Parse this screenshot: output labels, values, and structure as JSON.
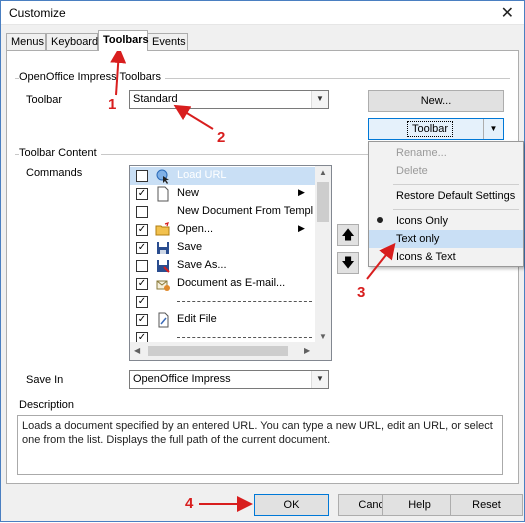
{
  "window": {
    "title": "Customize",
    "close_glyph": "✕"
  },
  "tabs": [
    {
      "label": "Menus",
      "active": false
    },
    {
      "label": "Keyboard",
      "active": false
    },
    {
      "label": "Toolbars",
      "active": true
    },
    {
      "label": "Events",
      "active": false
    }
  ],
  "toolbars_group": {
    "label": "OpenOffice Impress Toolbars",
    "toolbar_label": "Toolbar",
    "toolbar_value": "Standard",
    "new_button": "New...",
    "toolbar_button": "Toolbar"
  },
  "content_group": {
    "label": "Toolbar Content",
    "commands_label": "Commands",
    "items": [
      {
        "label": "Load URL",
        "checked": false,
        "icon": "globe-cursor-icon",
        "submenu": false,
        "selected": true
      },
      {
        "label": "New",
        "checked": true,
        "icon": "new-doc-icon",
        "submenu": true,
        "selected": false
      },
      {
        "label": "New Document From Templ",
        "checked": false,
        "icon": "template-icon",
        "submenu": false,
        "selected": false
      },
      {
        "label": "Open...",
        "checked": true,
        "icon": "open-folder-icon",
        "submenu": true,
        "selected": false
      },
      {
        "label": "Save",
        "checked": true,
        "icon": "floppy-icon",
        "submenu": false,
        "selected": false
      },
      {
        "label": "Save As...",
        "checked": false,
        "icon": "floppy-as-icon",
        "submenu": false,
        "selected": false
      },
      {
        "label": "Document as E-mail...",
        "checked": true,
        "icon": "email-icon",
        "submenu": false,
        "selected": false
      },
      {
        "label": "",
        "checked": true,
        "separator": true
      },
      {
        "label": "Edit File",
        "checked": true,
        "icon": "edit-file-icon",
        "submenu": false,
        "selected": false
      },
      {
        "label": "",
        "checked": true,
        "separator": true
      }
    ],
    "move_up_glyph": "🡅",
    "move_down_glyph": "🡇",
    "save_in_label": "Save In",
    "save_in_value": "OpenOffice Impress"
  },
  "toolbar_menu": {
    "items": [
      {
        "label": "Rename...",
        "disabled": true
      },
      {
        "label": "Delete",
        "disabled": true
      },
      {
        "label": "Restore Default Settings",
        "disabled": false
      },
      {
        "label": "Icons Only",
        "disabled": false,
        "bullet": true
      },
      {
        "label": "Text only",
        "disabled": false,
        "highlighted": true
      },
      {
        "label": "Icons & Text",
        "disabled": false
      }
    ]
  },
  "description": {
    "label": "Description",
    "text": "Loads a document specified by an entered URL. You can type a new URL, edit an URL, or select one from the list. Displays the full path of the current document."
  },
  "footer": {
    "ok": "OK",
    "cancel": "Cancel",
    "help": "Help",
    "reset": "Reset"
  },
  "annotations": {
    "a1": "1",
    "a2": "2",
    "a3": "3",
    "a4": "4",
    "color": "#d81e1e"
  }
}
